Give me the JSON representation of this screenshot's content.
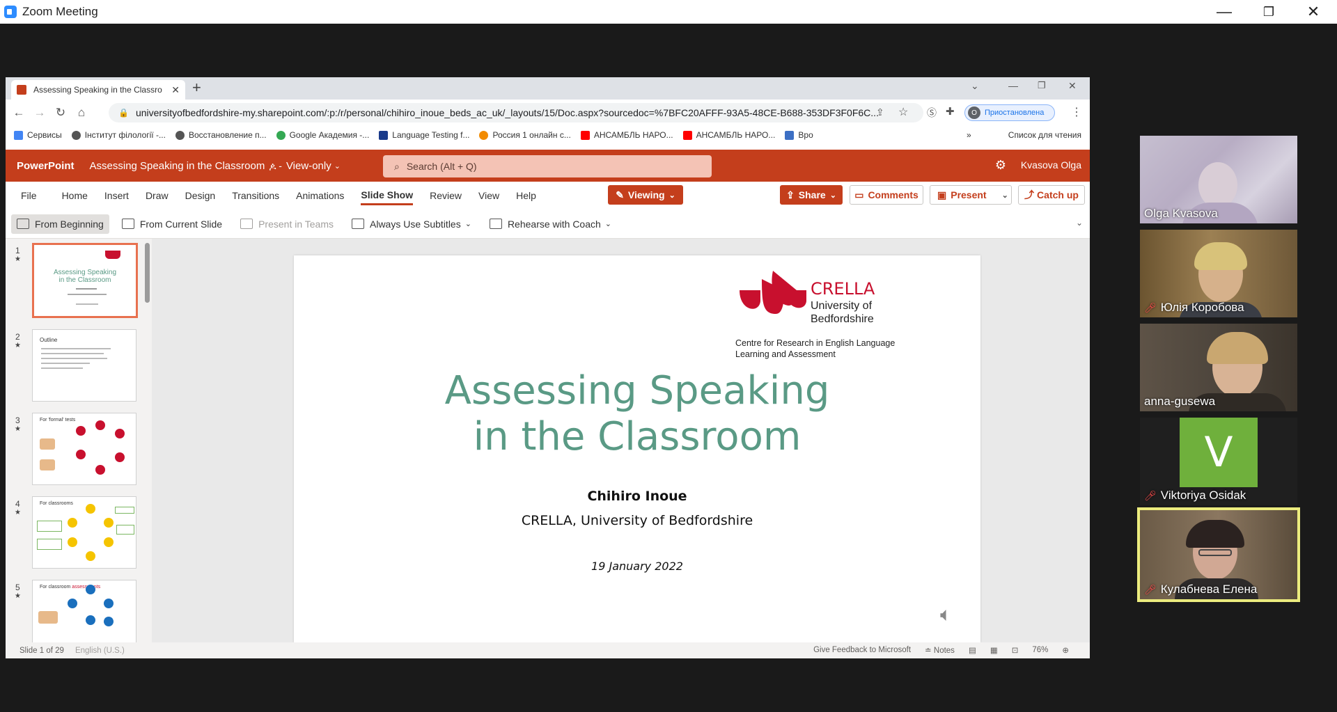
{
  "zoom": {
    "title": "Zoom Meeting",
    "minimize": "—",
    "restore": "❐",
    "close": "✕"
  },
  "browser": {
    "tab_title": "Assessing Speaking in the Classro",
    "tab_close": "✕",
    "new_tab": "+",
    "url": "universityofbedfordshire-my.sharepoint.com/:p:/r/personal/chihiro_inoue_beds_ac_uk/_layouts/15/Doc.aspx?sourcedoc=%7BFC20AFFF-93A5-48CE-B688-353DF3F0F6C...",
    "profile_initial": "O",
    "profile_status": "Приостановлена",
    "bookmarks": [
      "Сервисы",
      "Інститут філології -...",
      "Восстановление п...",
      "Google Академия -...",
      "Language Testing f...",
      "Россия 1 онлайн с...",
      "АНСАМБЛЬ НАРО...",
      "АНСАМБЛЬ НАРО...",
      "Bpo"
    ],
    "bookmark_more": "»",
    "reading_list": "Список для чтения"
  },
  "ppt": {
    "brand": "PowerPoint",
    "doc_title": "Assessing Speaking in the Classroom",
    "view_mode": "View-only",
    "search_placeholder": "Search (Alt + Q)",
    "user": "Kvasova Olga",
    "tabs": [
      "File",
      "Home",
      "Insert",
      "Draw",
      "Design",
      "Transitions",
      "Animations",
      "Slide Show",
      "Review",
      "View",
      "Help"
    ],
    "viewing": "Viewing",
    "share": "Share",
    "comments": "Comments",
    "present": "Present",
    "catch_up": "Catch up",
    "commands": [
      "From Beginning",
      "From Current Slide",
      "Present in Teams",
      "Always Use Subtitles",
      "Rehearse with Coach"
    ],
    "thumb_numbers": [
      "1",
      "2",
      "3",
      "4",
      "5"
    ],
    "slide": {
      "title_line1": "Assessing Speaking",
      "title_line2": "in the Classroom",
      "author": "Chihiro Inoue",
      "affiliation": "CRELLA, University of Bedfordshire",
      "date": "19 January 2022",
      "logo_name": "CRELLA",
      "logo_uni": "University of Bedfordshire",
      "logo_centre": "Centre for Research in English Language Learning and Assessment"
    },
    "status": {
      "slide_of": "Slide 1 of 29",
      "language": "English (U.S.)",
      "feedback": "Give Feedback to Microsoft",
      "notes": "Notes",
      "zoom": "76%"
    }
  },
  "participants": [
    {
      "name": "Olga Kvasova",
      "muted": false
    },
    {
      "name": "Юлія Коробова",
      "muted": true
    },
    {
      "name": "anna-gusewa",
      "muted": false
    },
    {
      "name": "Viktoriya Osidak",
      "muted": true,
      "initial": "V"
    },
    {
      "name": "Кулабнева Елена",
      "muted": true
    }
  ],
  "colors": {
    "ppt_accent": "#c43e1c",
    "slide_title": "#5a9a85",
    "active_speaker_border": "#ecec7e"
  }
}
